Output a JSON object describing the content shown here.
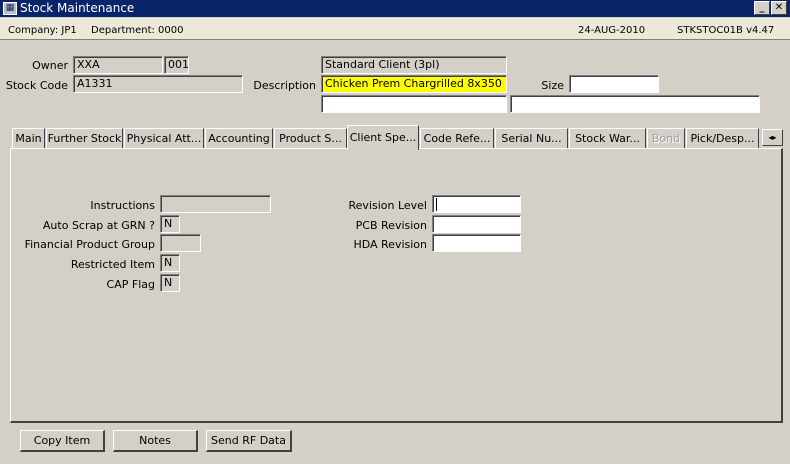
{
  "window": {
    "title": "Stock Maintenance",
    "minimize_glyph": "_",
    "close_glyph": "✕"
  },
  "infobar": {
    "company": "Company:  JP1",
    "department": "Department:  0000",
    "date": "24-AUG-2010",
    "module": "STKSTOC01B  v4.47"
  },
  "header": {
    "owner_label": "Owner",
    "owner_value": "XXA",
    "owner_code": "001",
    "stock_code_label": "Stock Code",
    "stock_code_value": "A1331",
    "client_name": "Standard Client (3pl)",
    "description_label": "Description",
    "description_value": "Chicken Prem Chargrilled 8x350",
    "size_label": "Size",
    "size_value": "",
    "extra1": "",
    "extra2": ""
  },
  "tabs": [
    {
      "label": "Main"
    },
    {
      "label": "Further Stock"
    },
    {
      "label": "Physical Att..."
    },
    {
      "label": "Accounting"
    },
    {
      "label": "Product S..."
    },
    {
      "label": "Client Spe..."
    },
    {
      "label": "Code Refe..."
    },
    {
      "label": "Serial Nu..."
    },
    {
      "label": "Stock War..."
    },
    {
      "label": "Bond"
    },
    {
      "label": "Pick/Desp..."
    }
  ],
  "tab_scroll": "◂▸",
  "client_specific": {
    "instructions_label": "Instructions",
    "instructions_value": "",
    "auto_scrap_label": "Auto Scrap at GRN ?",
    "auto_scrap_value": "N",
    "financial_group_label": "Financial Product Group",
    "financial_group_value": "",
    "restricted_label": "Restricted Item",
    "restricted_value": "N",
    "cap_flag_label": "CAP Flag",
    "cap_flag_value": "N",
    "revision_level_label": "Revision Level",
    "revision_level_value": "",
    "pcb_revision_label": "PCB Revision",
    "pcb_revision_value": "",
    "hda_revision_label": "HDA Revision",
    "hda_revision_value": ""
  },
  "buttons": {
    "copy_item": "Copy Item",
    "notes": "Notes",
    "send_rf": "Send RF Data"
  }
}
